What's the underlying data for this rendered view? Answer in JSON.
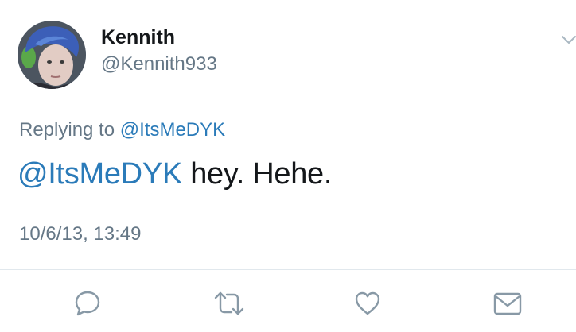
{
  "tweet": {
    "author": {
      "display_name": "Kennith",
      "handle": "@Kennith933"
    },
    "replying_to": {
      "prefix": "Replying to",
      "mention": "@ItsMeDYK"
    },
    "text": {
      "mention": "@ItsMeDYK",
      "body": "hey. Hehe."
    },
    "timestamp": "10/6/13, 13:49"
  },
  "actions": [
    {
      "name": "reply",
      "icon": "reply-bubble-icon"
    },
    {
      "name": "retweet",
      "icon": "retweet-icon"
    },
    {
      "name": "like",
      "icon": "heart-icon"
    },
    {
      "name": "direct-message",
      "icon": "envelope-icon"
    }
  ],
  "colors": {
    "link": "#2b7bb9",
    "secondary_text": "#657786",
    "primary_text": "#14171a",
    "icon": "#8899a6",
    "divider": "#e1e8ed"
  }
}
